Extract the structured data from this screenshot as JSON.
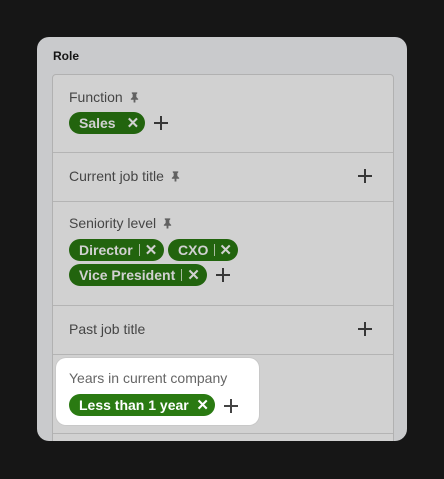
{
  "panel": {
    "title": "Role"
  },
  "rows": {
    "function": {
      "label": "Function",
      "chips": [
        "Sales"
      ]
    },
    "current_title": {
      "label": "Current job title"
    },
    "seniority": {
      "label": "Seniority level",
      "chips": [
        "Director",
        "CXO",
        "Vice President"
      ]
    },
    "past_title": {
      "label": "Past job title"
    },
    "years_company": {
      "label": "Years in current company",
      "chips": [
        "Less than 1 year"
      ]
    }
  },
  "colors": {
    "chip": "#2a7a12",
    "page_bg": "#1c1c1c",
    "panel_bg": "#f6f7f9"
  },
  "icons": {
    "pin": "pin-icon",
    "remove": "close-icon",
    "add": "plus-icon"
  }
}
